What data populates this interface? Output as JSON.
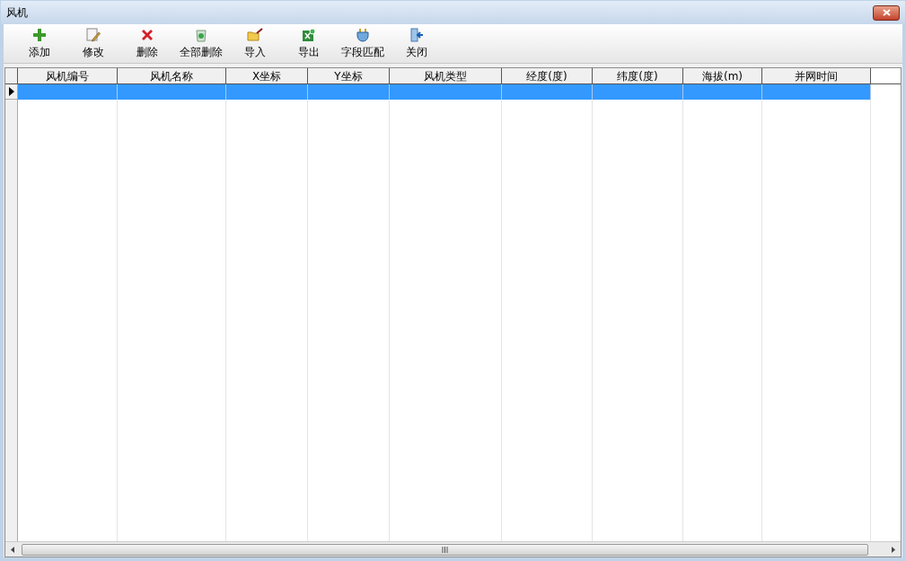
{
  "window": {
    "title": "风机"
  },
  "toolbar": [
    {
      "label": "添加",
      "kind": "add"
    },
    {
      "label": "修改",
      "kind": "edit"
    },
    {
      "label": "删除",
      "kind": "delete"
    },
    {
      "label": "全部删除",
      "kind": "clear"
    },
    {
      "label": "导入",
      "kind": "import"
    },
    {
      "label": "导出",
      "kind": "export"
    },
    {
      "label": "字段匹配",
      "kind": "match"
    },
    {
      "label": "关闭",
      "kind": "close"
    }
  ],
  "table": {
    "columns": [
      "风机编号",
      "风机名称",
      "X坐标",
      "Y坐标",
      "风机类型",
      "经度(度)",
      "纬度(度)",
      "海拔(m)",
      "并网时间"
    ],
    "rows": [
      {
        "selected": true
      }
    ]
  }
}
